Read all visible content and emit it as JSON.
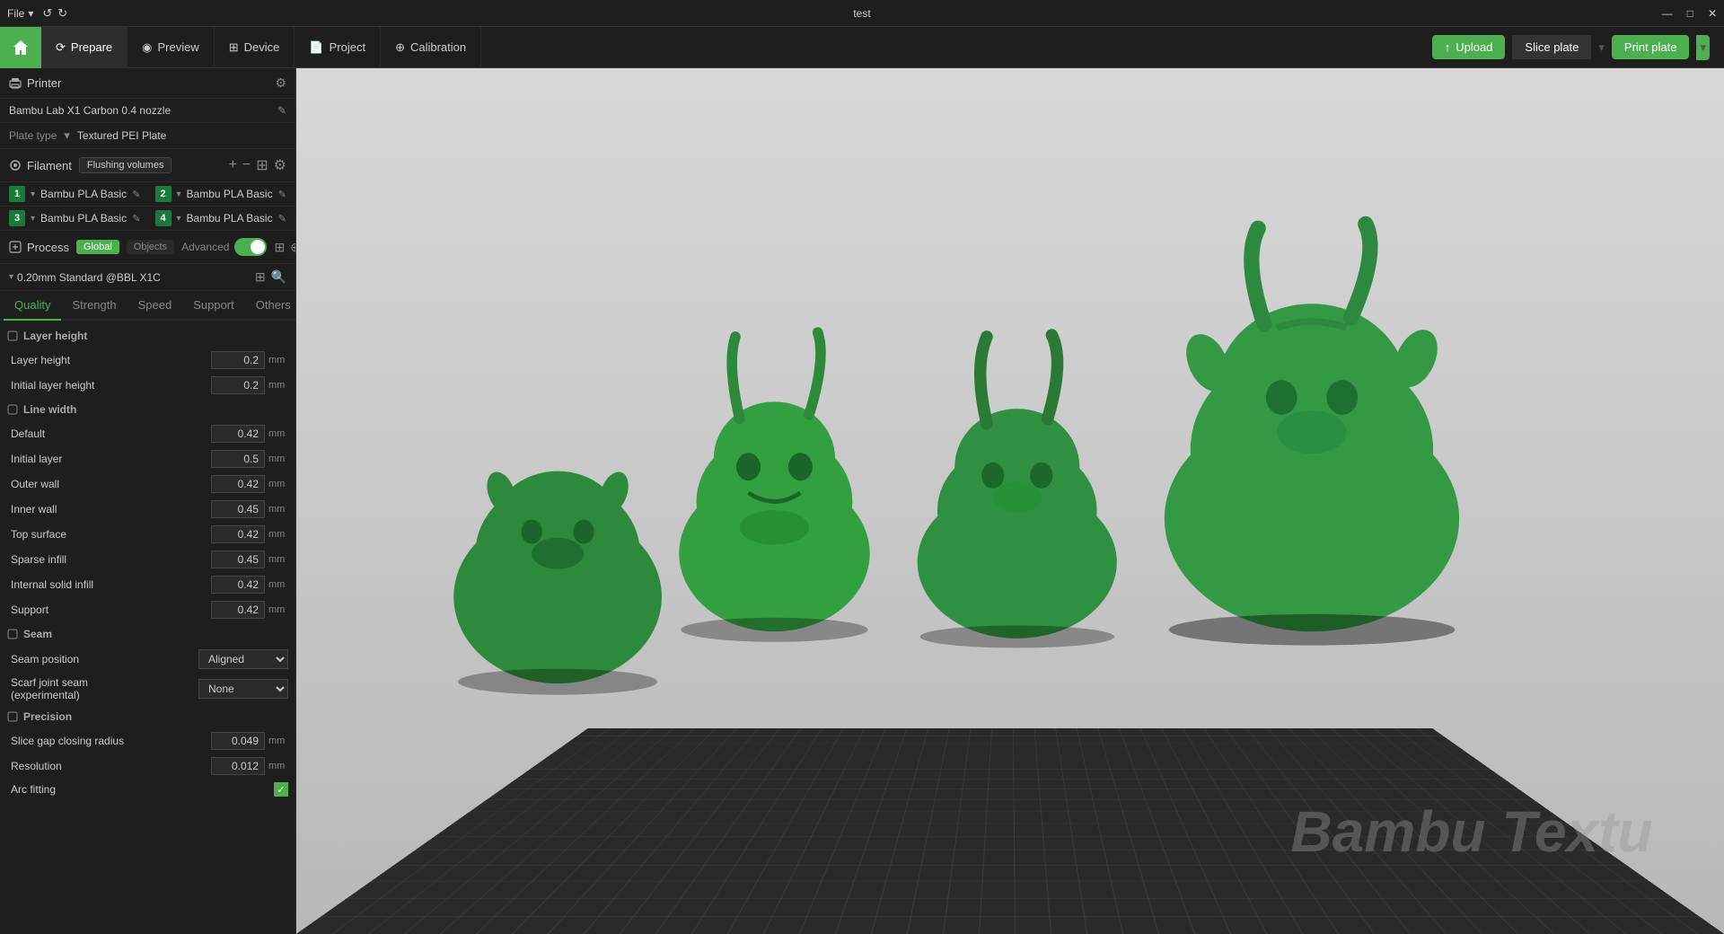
{
  "titlebar": {
    "title": "test",
    "file_menu": "File",
    "min": "—",
    "max": "□",
    "close": "✕"
  },
  "nav": {
    "home_icon": "⌂",
    "tabs": [
      {
        "label": "Prepare",
        "icon": "⟳",
        "active": true
      },
      {
        "label": "Preview",
        "icon": "◉"
      },
      {
        "label": "Device",
        "icon": "⊞"
      },
      {
        "label": "Project",
        "icon": "📄"
      },
      {
        "label": "Calibration",
        "icon": "⊕"
      }
    ],
    "upload_label": "Upload",
    "slice_plate_label": "Slice plate",
    "print_plate_label": "Print plate"
  },
  "sidebar": {
    "printer_section_label": "Printer",
    "printer_name": "Bambu Lab X1 Carbon 0.4 nozzle",
    "plate_type_label": "Plate type",
    "plate_type_value": "Textured PEI Plate",
    "filament_section_label": "Filament",
    "flush_volumes_label": "Flushing volumes",
    "filaments": [
      {
        "num": "1",
        "color": "#1a7a3c",
        "name": "Bambu PLA Basic"
      },
      {
        "num": "2",
        "color": "#1a7a3c",
        "name": "Bambu PLA Basic"
      },
      {
        "num": "3",
        "color": "#1a7a3c",
        "name": "Bambu PLA Basic"
      },
      {
        "num": "4",
        "color": "#1a7a3c",
        "name": "Bambu PLA Basic"
      }
    ],
    "process_section_label": "Process",
    "tag_global": "Global",
    "tag_objects": "Objects",
    "advanced_label": "Advanced",
    "profile_name": "0.20mm Standard @BBL X1C",
    "tabs": [
      {
        "label": "Quality",
        "active": true
      },
      {
        "label": "Strength"
      },
      {
        "label": "Speed"
      },
      {
        "label": "Support"
      },
      {
        "label": "Others"
      }
    ],
    "quality_tab": "Quality",
    "layer_height_group": "Layer height",
    "layer_height_label": "Layer height",
    "layer_height_value": "0.2",
    "layer_height_unit": "mm",
    "initial_layer_height_label": "Initial layer height",
    "initial_layer_height_value": "0.2",
    "initial_layer_height_unit": "mm",
    "line_width_group": "Line width",
    "lw_default_label": "Default",
    "lw_default_value": "0.42",
    "lw_default_unit": "mm",
    "lw_initial_label": "Initial layer",
    "lw_initial_value": "0.5",
    "lw_initial_unit": "mm",
    "lw_outer_wall_label": "Outer wall",
    "lw_outer_wall_value": "0.42",
    "lw_outer_wall_unit": "mm",
    "lw_inner_wall_label": "Inner wall",
    "lw_inner_wall_value": "0.45",
    "lw_inner_wall_unit": "mm",
    "lw_top_surface_label": "Top surface",
    "lw_top_surface_value": "0.42",
    "lw_top_surface_unit": "mm",
    "lw_sparse_infill_label": "Sparse infill",
    "lw_sparse_infill_value": "0.45",
    "lw_sparse_infill_unit": "mm",
    "lw_internal_solid_label": "Internal solid infill",
    "lw_internal_solid_value": "0.42",
    "lw_internal_solid_unit": "mm",
    "lw_support_label": "Support",
    "lw_support_value": "0.42",
    "lw_support_unit": "mm",
    "seam_group": "Seam",
    "seam_position_label": "Seam position",
    "seam_position_value": "Aligned",
    "scarf_joint_label": "Scarf joint seam\n(experimental)",
    "scarf_joint_value": "None",
    "precision_group": "Precision",
    "slice_gap_label": "Slice gap closing radius",
    "slice_gap_value": "0.049",
    "slice_gap_unit": "mm",
    "resolution_label": "Resolution",
    "resolution_value": "0.012",
    "resolution_unit": "mm",
    "arc_fitting_label": "Arc fitting",
    "arc_fitting_checked": true
  },
  "toolbar_icons": [
    "⬚",
    "⊞",
    "↺",
    "▭",
    "◎",
    "⬡",
    "⬡",
    "⊕",
    "⊕",
    "⊕",
    "◻",
    "⊞",
    "⊞",
    "⊞",
    "⊞",
    "⊞",
    "⊞",
    "⊞",
    "⬚"
  ],
  "viewport": {
    "plate_watermark": "Bambu Textu"
  }
}
